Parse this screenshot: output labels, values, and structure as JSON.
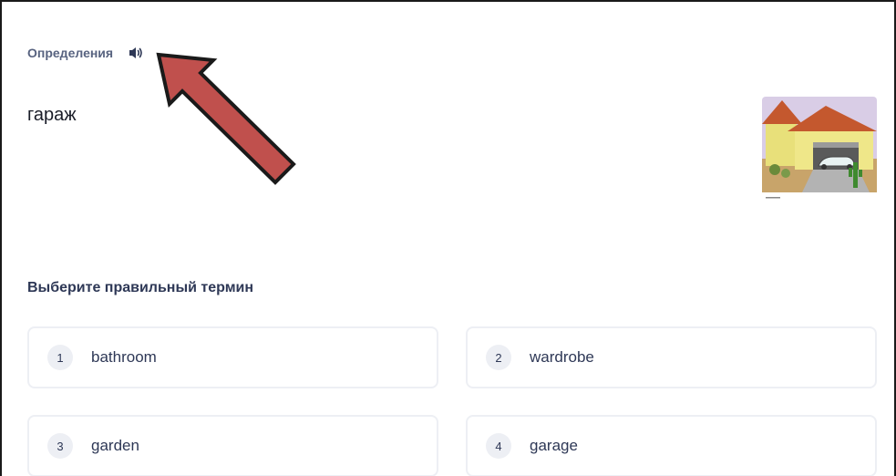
{
  "card": {
    "definition_label": "Определения",
    "speaker_icon": "speaker-icon",
    "term": "гараж",
    "image_icon": "garage-illustration"
  },
  "question": {
    "prompt": "Выберите правильный термин"
  },
  "options": [
    {
      "number": "1",
      "label": "bathroom"
    },
    {
      "number": "2",
      "label": "wardrobe"
    },
    {
      "number": "3",
      "label": "garden"
    },
    {
      "number": "4",
      "label": "garage"
    }
  ],
  "colors": {
    "arrow_fill": "#c0504d",
    "arrow_stroke": "#1a1a1a",
    "option_border": "#edeff4",
    "label_gray": "#586380",
    "text_dark": "#2e3856"
  }
}
